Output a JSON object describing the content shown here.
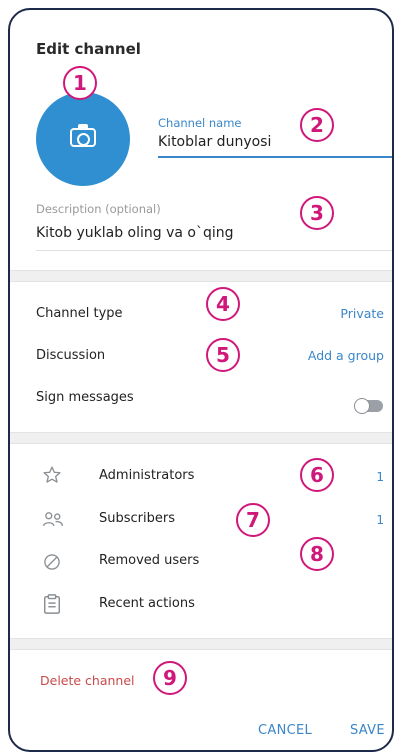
{
  "header": {
    "title": "Edit channel"
  },
  "channel_name": {
    "label": "Channel name",
    "value": "Kitoblar dunyosi"
  },
  "description": {
    "label": "Description (optional)",
    "value": "Kitob yuklab oling va o`qing"
  },
  "settings": {
    "channel_type": {
      "label": "Channel type",
      "value": "Private"
    },
    "discussion": {
      "label": "Discussion",
      "value": "Add a group"
    },
    "sign_messages": {
      "label": "Sign messages",
      "enabled": false
    }
  },
  "management": {
    "administrators": {
      "label": "Administrators",
      "count": "1",
      "icon": "star-icon"
    },
    "subscribers": {
      "label": "Subscribers",
      "count": "1",
      "icon": "people-icon"
    },
    "removed_users": {
      "label": "Removed users",
      "icon": "block-icon"
    },
    "recent_actions": {
      "label": "Recent actions",
      "icon": "clipboard-icon"
    }
  },
  "danger": {
    "delete_label": "Delete channel"
  },
  "footer": {
    "cancel_label": "CANCEL",
    "save_label": "SAVE"
  },
  "badges": [
    "1",
    "2",
    "3",
    "4",
    "5",
    "6",
    "7",
    "8",
    "9"
  ],
  "colors": {
    "accent": "#3a86c8",
    "avatar": "#2f8fd0",
    "danger": "#c94a4a",
    "badge": "#d0177a"
  }
}
